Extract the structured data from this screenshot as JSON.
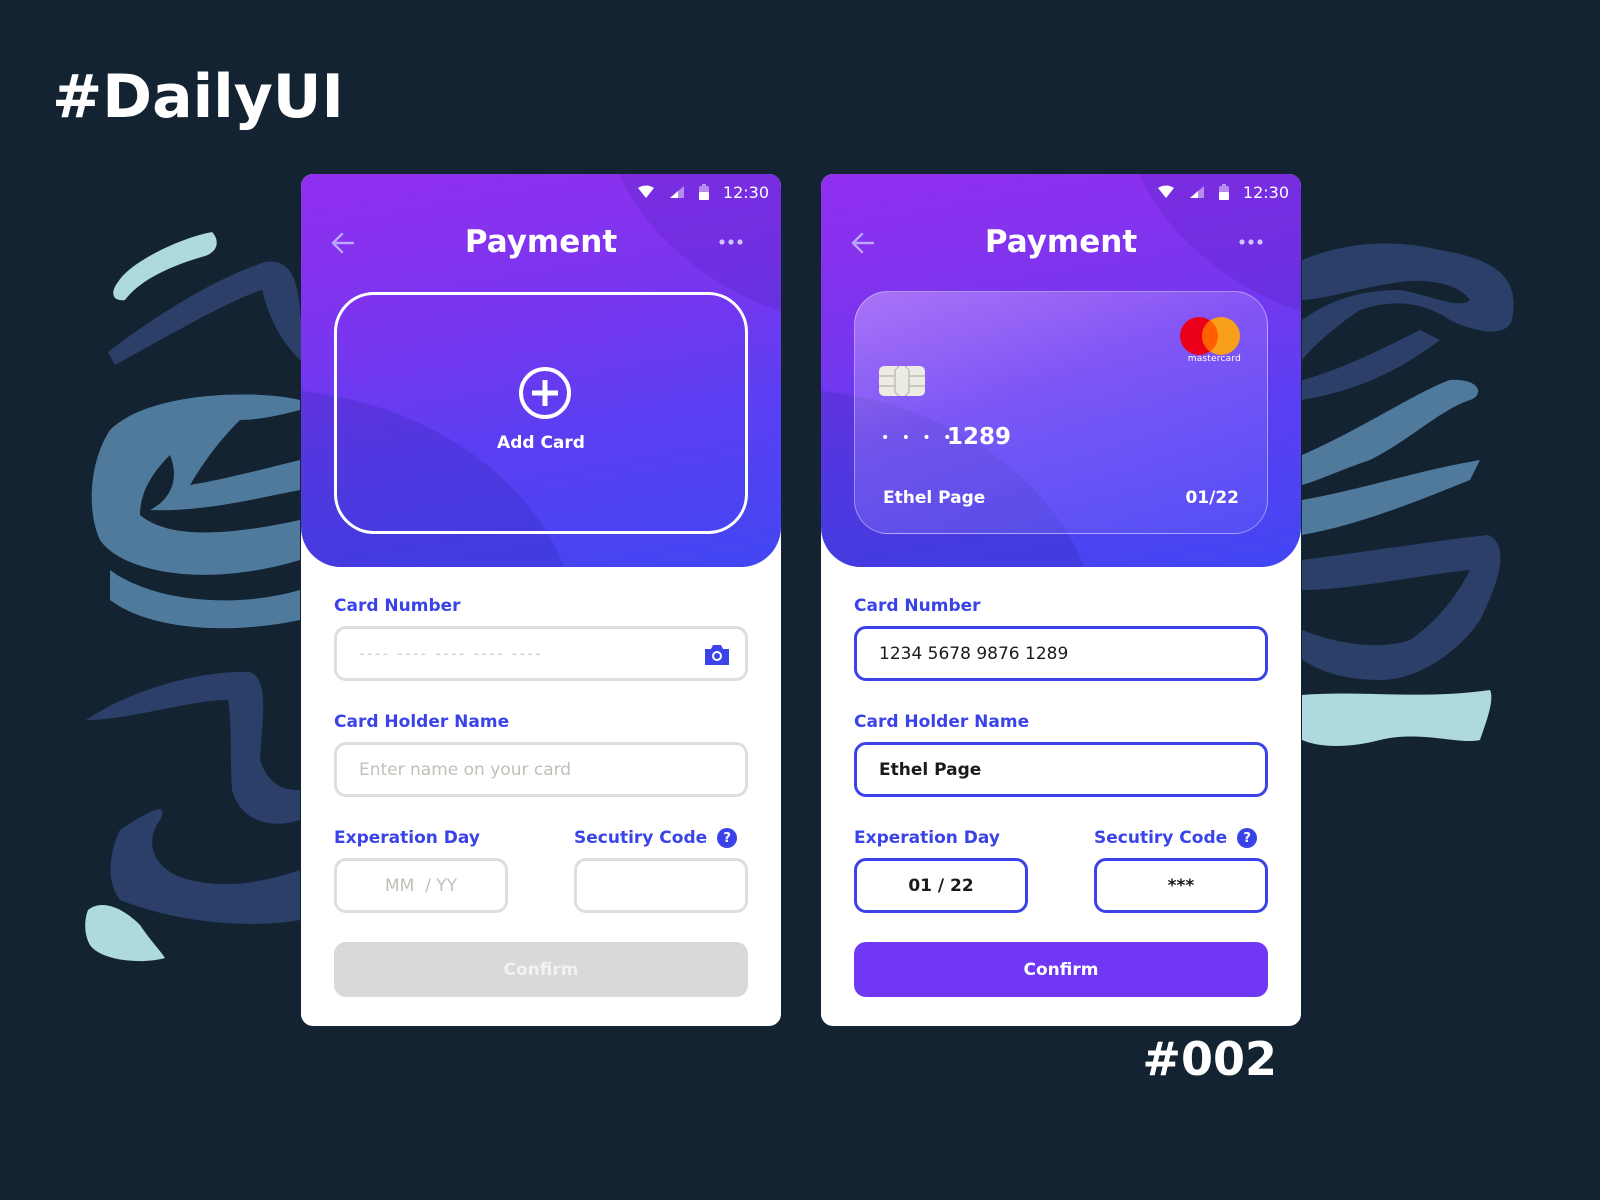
{
  "brand": {
    "title": "#DailyUI",
    "shot_number": "#002"
  },
  "colors": {
    "background": "#132331",
    "accent_blue": "#3b43e8",
    "button_purple": "#7037f5",
    "button_disabled": "#d9d9d9",
    "stroke_dark": "#2b3f69",
    "stroke_mid": "#4f7a9c",
    "stroke_light": "#aed9de"
  },
  "screens": [
    {
      "state": "empty",
      "status_bar": {
        "time": "12:30",
        "icons": [
          "wifi-icon",
          "signal-icon",
          "battery-icon"
        ]
      },
      "header": {
        "title": "Payment",
        "back_icon": "arrow-left-icon",
        "more_icon": "more-horizontal-icon"
      },
      "add_card": {
        "label": "Add Card",
        "icon": "plus-circle-icon"
      },
      "form": {
        "card_number": {
          "label": "Card Number",
          "placeholder": "---- ---- ---- ---- ----",
          "value": "",
          "icon": "camera-icon"
        },
        "holder_name": {
          "label": "Card Holder Name",
          "placeholder": "Enter name on your card",
          "value": ""
        },
        "expiration": {
          "label": "Experation Day",
          "placeholder": "MM  / YY",
          "value": ""
        },
        "security_code": {
          "label": "Secutiry Code",
          "placeholder": "",
          "value": "",
          "help": "?"
        },
        "confirm": {
          "label": "Confirm",
          "enabled": false
        }
      }
    },
    {
      "state": "filled",
      "status_bar": {
        "time": "12:30",
        "icons": [
          "wifi-icon",
          "signal-icon",
          "battery-icon"
        ]
      },
      "header": {
        "title": "Payment",
        "back_icon": "arrow-left-icon",
        "more_icon": "more-horizontal-icon"
      },
      "card": {
        "masked": "• • • •",
        "last4": "1289",
        "holder": "Ethel Page",
        "expiry": "01/22",
        "brand": "mastercard"
      },
      "form": {
        "card_number": {
          "label": "Card Number",
          "value": "1234 5678 9876 1289"
        },
        "holder_name": {
          "label": "Card Holder Name",
          "value": "Ethel Page"
        },
        "expiration": {
          "label": "Experation Day",
          "value": "01 / 22"
        },
        "security_code": {
          "label": "Secutiry Code",
          "value": "***",
          "help": "?"
        },
        "confirm": {
          "label": "Confirm",
          "enabled": true
        }
      }
    }
  ]
}
